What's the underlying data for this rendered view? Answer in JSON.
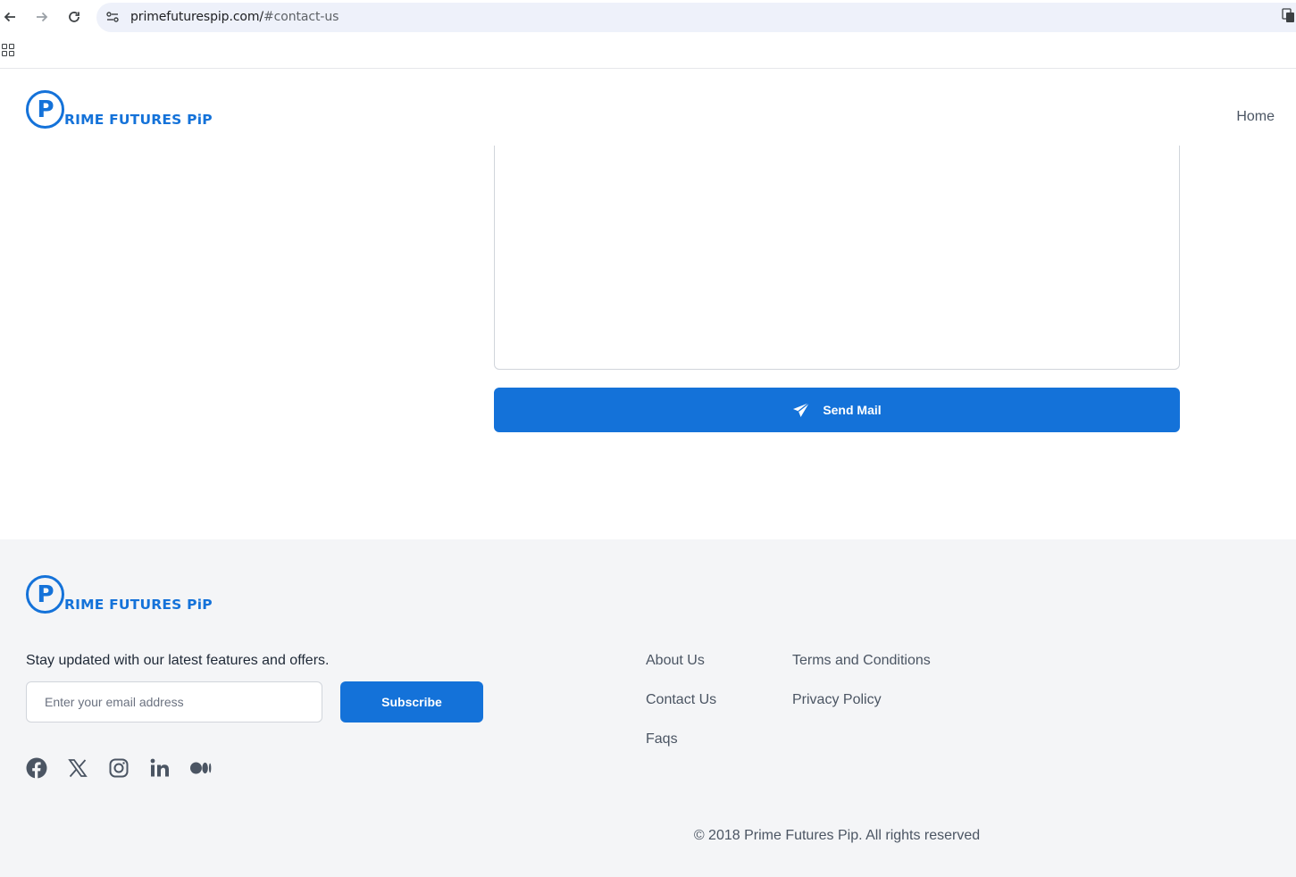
{
  "browser": {
    "url_host": "primefuturespip.com/",
    "url_path": "#contact-us"
  },
  "header": {
    "logo_letter": "P",
    "logo_text": "RIME FUTURES PiP",
    "nav_home": "Home"
  },
  "contact": {
    "send_label": "Send Mail"
  },
  "footer": {
    "logo_letter": "P",
    "logo_text": "RIME FUTURES PiP",
    "tagline": "Stay updated with our latest features and offers.",
    "email_placeholder": "Enter your email address",
    "subscribe_label": "Subscribe",
    "socials": [
      "facebook-icon",
      "x-icon",
      "instagram-icon",
      "linkedin-icon",
      "medium-icon"
    ],
    "links_col1": [
      "About Us",
      "Contact Us",
      "Faqs"
    ],
    "links_col2": [
      "Terms and Conditions",
      "Privacy Policy"
    ],
    "copyright": "© 2018 Prime Futures Pip. All rights reserved"
  },
  "colors": {
    "brand": "#1472d9",
    "footer_bg": "#f4f5f7"
  }
}
